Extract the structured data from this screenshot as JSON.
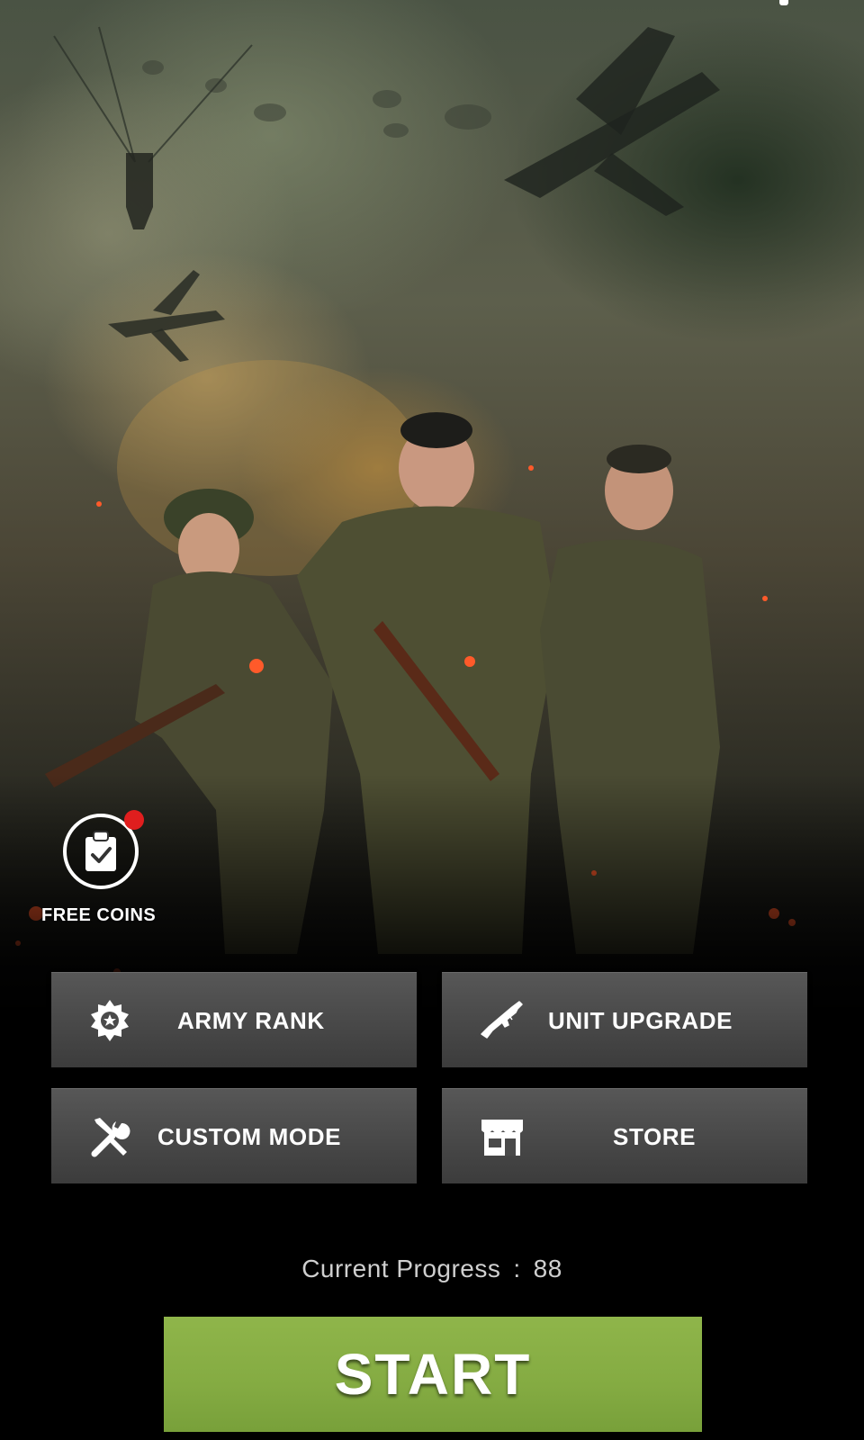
{
  "screen": {
    "background": "war-scene-artwork",
    "accent_color": "#84ab42",
    "button_color": "#4a4a4a",
    "notification_color": "#e01e1e"
  },
  "free_coins": {
    "label": "FREE COINS",
    "icon": "clipboard-check-icon",
    "has_notification": true
  },
  "menu": {
    "army_rank": {
      "label": "ARMY RANK",
      "icon": "medal-icon"
    },
    "unit_upgrade": {
      "label": "UNIT UPGRADE",
      "icon": "rifle-icon"
    },
    "custom_mode": {
      "label": "CUSTOM MODE",
      "icon": "wrench-screwdriver-icon"
    },
    "store": {
      "label": "STORE",
      "icon": "shop-icon"
    }
  },
  "progress": {
    "label": "Current Progress",
    "separator": ":",
    "value": "88"
  },
  "start_button": {
    "label": "START"
  }
}
